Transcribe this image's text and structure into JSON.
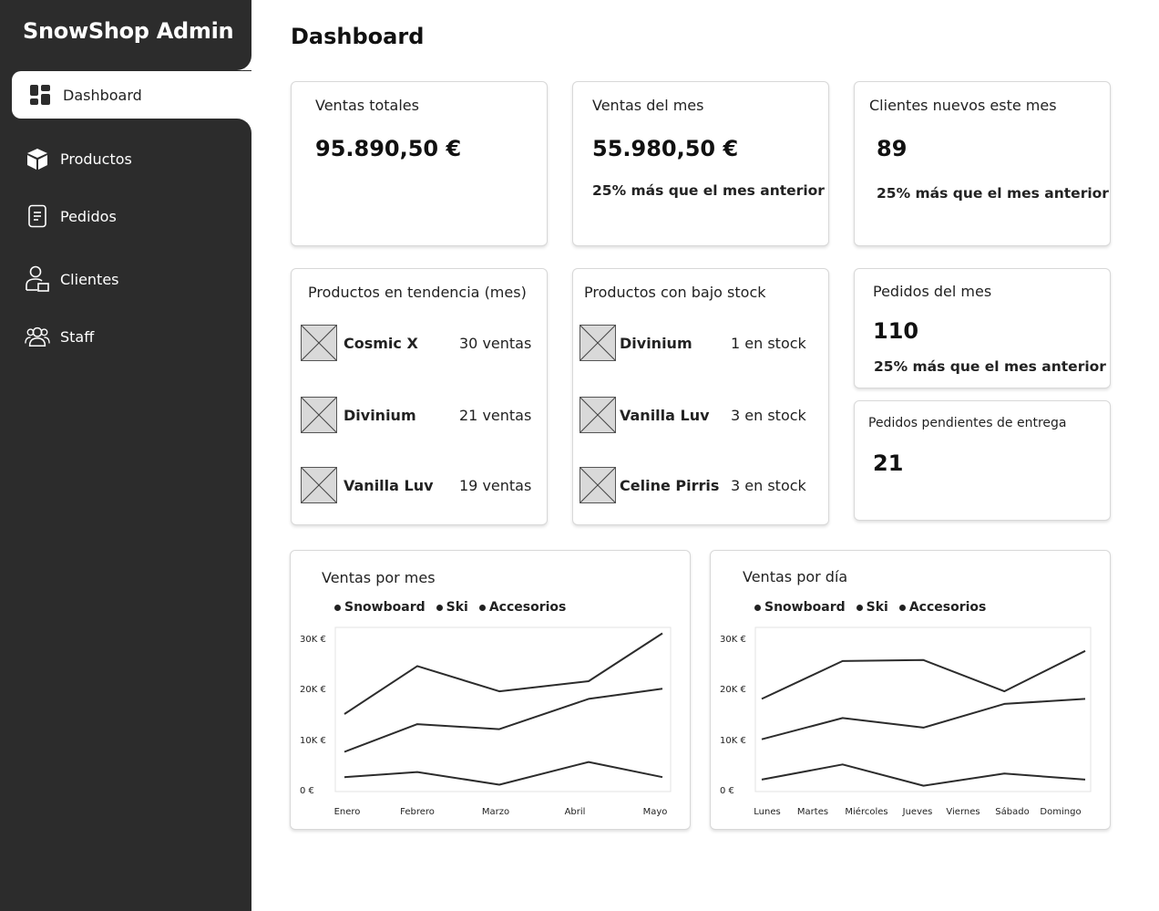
{
  "sidebar": {
    "brand": "SnowShop Admin",
    "items": [
      {
        "label": "Dashboard",
        "icon": "dashboard-icon"
      },
      {
        "label": "Productos",
        "icon": "box-icon"
      },
      {
        "label": "Pedidos",
        "icon": "document-icon"
      },
      {
        "label": "Clientes",
        "icon": "user-icon"
      },
      {
        "label": "Staff",
        "icon": "group-icon"
      }
    ]
  },
  "page": {
    "title": "Dashboard"
  },
  "stats": {
    "ventas_totales": {
      "label": "Ventas totales",
      "value": "95.890,50 €"
    },
    "ventas_mes": {
      "label": "Ventas del mes",
      "value": "55.980,50 €",
      "note": "25% más que el mes anterior"
    },
    "clientes_nuevos": {
      "label": "Clientes nuevos este mes",
      "value": "89",
      "note": "25% más que el mes anterior"
    },
    "pedidos_mes": {
      "label": "Pedidos del mes",
      "value": "110",
      "note": "25% más que el mes anterior"
    },
    "pedidos_pendientes": {
      "label": "Pedidos pendientes de entrega",
      "value": "21"
    }
  },
  "tendencia": {
    "title": "Productos en tendencia (mes)",
    "rows": [
      {
        "name": "Cosmic X",
        "value": "30 ventas"
      },
      {
        "name": "Divinium",
        "value": "21 ventas"
      },
      {
        "name": "Vanilla Luv",
        "value": "19 ventas"
      }
    ]
  },
  "bajo_stock": {
    "title": "Productos con bajo stock",
    "rows": [
      {
        "name": "Divinium",
        "value": "1 en stock"
      },
      {
        "name": "Vanilla Luv",
        "value": "3 en stock"
      },
      {
        "name": "Celine Pirris",
        "value": "3 en stock"
      }
    ]
  },
  "chart_data": [
    {
      "type": "line",
      "title": "Ventas por mes",
      "categories": [
        "Enero",
        "Febrero",
        "Marzo",
        "Abril",
        "Mayo"
      ],
      "yticks": [
        "0 €",
        "10K €",
        "20K €",
        "30K €"
      ],
      "ylim": [
        0,
        32000
      ],
      "legend": [
        "Snowboard",
        "Ski",
        "Accesorios"
      ],
      "series": [
        {
          "values": [
            15000,
            24500,
            19500,
            21500,
            31000
          ]
        },
        {
          "values": [
            7500,
            13000,
            12000,
            18000,
            20000
          ]
        },
        {
          "values": [
            2500,
            3500,
            1000,
            5500,
            2500
          ]
        }
      ]
    },
    {
      "type": "line",
      "title": "Ventas por día",
      "categories": [
        "Lunes",
        "Martes",
        "Miércoles",
        "Jueves",
        "Viernes",
        "Sábado",
        "Domingo"
      ],
      "yticks": [
        "0 €",
        "10K €",
        "20K €",
        "30K €"
      ],
      "ylim": [
        0,
        32000
      ],
      "legend": [
        "Snowboard",
        "Ski",
        "Accesorios"
      ],
      "series": [
        {
          "values": [
            18000,
            25500,
            25700,
            19500,
            27500
          ]
        },
        {
          "values": [
            10000,
            14200,
            12300,
            17000,
            18000
          ]
        },
        {
          "values": [
            2000,
            5000,
            800,
            3200,
            2000
          ]
        }
      ]
    }
  ]
}
